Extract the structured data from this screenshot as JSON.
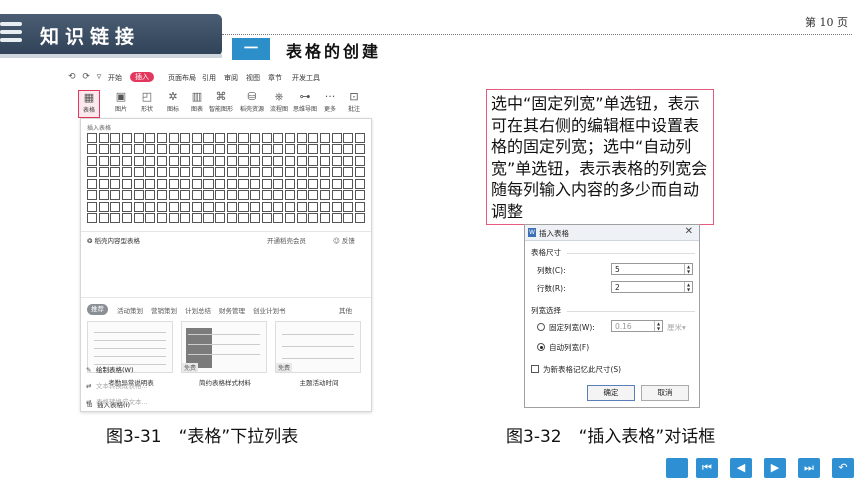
{
  "header": {
    "title": "知识链接",
    "page_number": "第 10 页",
    "section_number": "一",
    "section_title": "表格的创建"
  },
  "left_figure": {
    "menu": {
      "quick_icons": "⟲ ⟳ ▿",
      "items": [
        "开始",
        "插入",
        "页面布局",
        "引用",
        "审阅",
        "视图",
        "章节",
        "开发工具"
      ],
      "active": "插入"
    },
    "ribbon": [
      "表格",
      "图片",
      "形状",
      "图标",
      "图表",
      "智能图形",
      "稻壳资源",
      "流程图",
      "思维导图",
      "更多",
      "批注"
    ],
    "dropdown": {
      "insert_table_label": "插入表格",
      "grid_cols": 24,
      "grid_rows": 8,
      "content_table_label": "稻壳内容型表格",
      "member_label": "开通稻壳会员",
      "feedback_label": "反馈",
      "tabs": [
        "推荐",
        "活动策划",
        "营销策划",
        "计划总结",
        "财务管理",
        "创业计划书"
      ],
      "other_label": "其他",
      "templates": [
        {
          "caption": "考勤异常说明表",
          "badge": ""
        },
        {
          "caption": "简约表格样式材料",
          "badge": "免费"
        },
        {
          "caption": "主题活动时间",
          "badge": "免费"
        }
      ],
      "commands": [
        {
          "label": "插入表格(I)",
          "icon": "⊞",
          "enabled": true
        },
        {
          "label": "绘制表格(W)",
          "icon": "✎",
          "enabled": true
        },
        {
          "label": "文本转换成表格...",
          "icon": "⇄",
          "enabled": false
        },
        {
          "label": "表格转换成文本...",
          "icon": "⇄",
          "enabled": false
        }
      ]
    },
    "caption": "图3-31　“表格”下拉列表"
  },
  "callout": {
    "text": "选中“固定列宽”单选钮，表示可在其右侧的编辑框中设置表格的固定列宽；选中“自动列宽”单选钮，表示表格的列宽会随每列输入内容的多少而自动调整"
  },
  "dialog": {
    "title": "插入表格",
    "size_section": "表格尺寸",
    "cols_label": "列数(C):",
    "cols_value": "5",
    "rows_label": "行数(R):",
    "rows_value": "2",
    "width_section": "列宽选择",
    "fixed_label": "固定列宽(W):",
    "fixed_value": "0.16",
    "unit_label": "厘米",
    "auto_label": "自动列宽(F)",
    "selected": "auto",
    "remember_label": "为新表格记忆此尺寸(S)",
    "remember_checked": false,
    "ok_label": "确定",
    "cancel_label": "取消"
  },
  "right_caption": "图3-32　“插入表格”对话框",
  "nav_buttons": [
    "first-page",
    "previous-page",
    "play",
    "next-page",
    "last-page",
    "return"
  ],
  "colors": {
    "accent_pink": "#e65a7e",
    "header_blue": "#2c8fc9",
    "nav_blue": "#2e8fd3"
  }
}
